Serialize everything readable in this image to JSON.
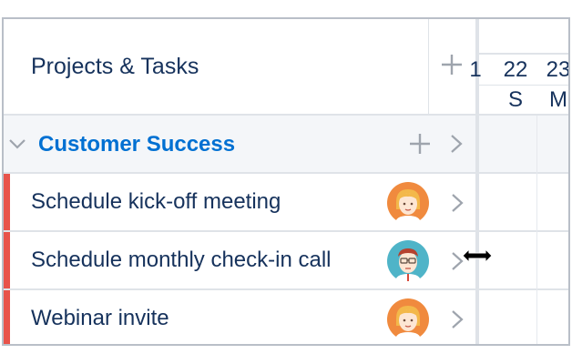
{
  "header": {
    "title": "Projects & Tasks",
    "add_icon": "plus-icon"
  },
  "group": {
    "title": "Customer Success",
    "expand_icon": "chevron-down-icon",
    "add_icon": "plus-icon",
    "arrow_icon": "chevron-right-icon"
  },
  "tasks": [
    {
      "label": "Schedule kick-off meeting",
      "avatar": "female-avatar",
      "stripe_color": "#e8534a"
    },
    {
      "label": "Schedule monthly check-in call",
      "avatar": "male-avatar",
      "stripe_color": "#e8534a"
    },
    {
      "label": "Webinar invite",
      "avatar": "female-avatar",
      "stripe_color": "#e8534a"
    }
  ],
  "timeline": {
    "dates": [
      "1",
      "22",
      "23"
    ],
    "days": [
      "",
      "S",
      "M"
    ]
  },
  "colors": {
    "accent": "#0070d2",
    "text": "#16325c",
    "stripe": "#e8534a",
    "border": "#dfe3e8",
    "group_bg": "#f4f6f9"
  }
}
